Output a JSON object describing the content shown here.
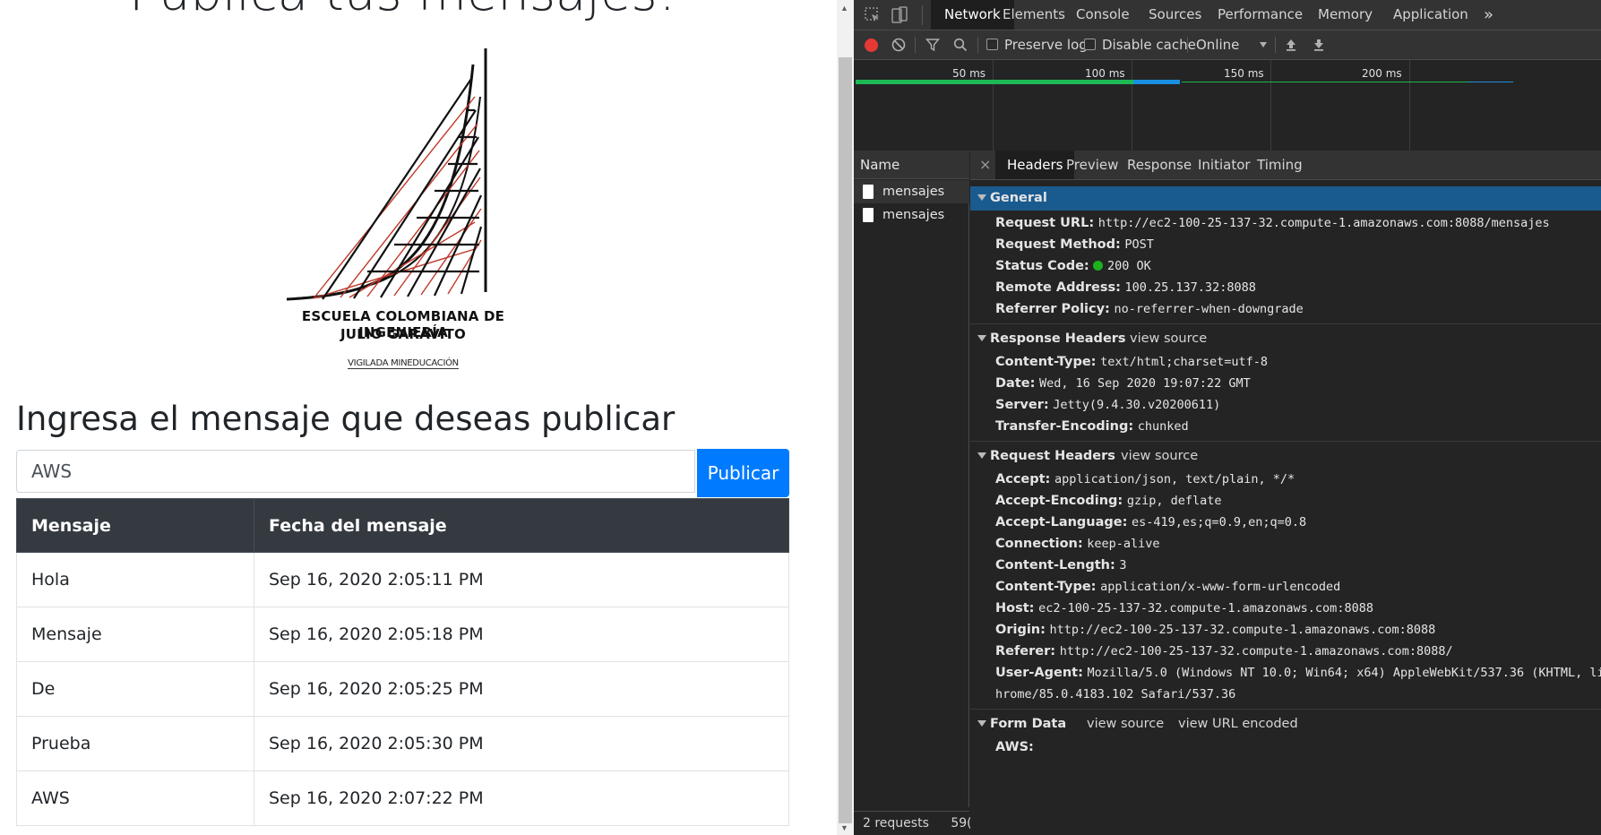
{
  "page": {
    "title": "Publica tus mensajes!",
    "logo": {
      "line1": "Escuela Colombiana de Ingeniería",
      "line2": "Julio Garavito",
      "line3": "VIGILADA MINEDUCACIÓN"
    },
    "heading": "Ingresa el mensaje que deseas publicar",
    "input_value": "AWS",
    "publish_label": "Publicar",
    "table": {
      "headers": [
        "Mensaje",
        "Fecha del mensaje"
      ],
      "rows": [
        [
          "Hola",
          "Sep 16, 2020 2:05:11 PM"
        ],
        [
          "Mensaje",
          "Sep 16, 2020 2:05:18 PM"
        ],
        [
          "De",
          "Sep 16, 2020 2:05:25 PM"
        ],
        [
          "Prueba",
          "Sep 16, 2020 2:05:30 PM"
        ],
        [
          "AWS",
          "Sep 16, 2020 2:07:22 PM"
        ]
      ]
    }
  },
  "devtools": {
    "tabs": [
      "Network",
      "Elements",
      "Console",
      "Sources",
      "Performance",
      "Memory",
      "Application"
    ],
    "more_tabs": "»",
    "toolbar": {
      "preserve_log": "Preserve log",
      "disable_cache": "Disable cache",
      "throttle": "Online"
    },
    "timeline_ticks": [
      "50 ms",
      "100 ms",
      "150 ms",
      "200 ms"
    ],
    "name_header": "Name",
    "requests": [
      "mensajes",
      "mensajes"
    ],
    "status_bar": "2 requests",
    "status_bar_cut": "59(",
    "detail_tabs": [
      "Headers",
      "Preview",
      "Response",
      "Initiator",
      "Timing"
    ],
    "close_glyph": "×",
    "general": {
      "title": "General",
      "items": [
        {
          "k": "Request URL:",
          "v": "http://ec2-100-25-137-32.compute-1.amazonaws.com:8088/mensajes"
        },
        {
          "k": "Request Method:",
          "v": "POST"
        },
        {
          "k": "Status Code:",
          "v": "200 OK"
        },
        {
          "k": "Remote Address:",
          "v": "100.25.137.32:8088"
        },
        {
          "k": "Referrer Policy:",
          "v": "no-referrer-when-downgrade"
        }
      ]
    },
    "response_headers": {
      "title": "Response Headers",
      "view_source": "view source",
      "items": [
        {
          "k": "Content-Type:",
          "v": "text/html;charset=utf-8"
        },
        {
          "k": "Date:",
          "v": "Wed, 16 Sep 2020 19:07:22 GMT"
        },
        {
          "k": "Server:",
          "v": "Jetty(9.4.30.v20200611)"
        },
        {
          "k": "Transfer-Encoding:",
          "v": "chunked"
        }
      ]
    },
    "request_headers": {
      "title": "Request Headers",
      "view_source": "view source",
      "items": [
        {
          "k": "Accept:",
          "v": "application/json, text/plain, */*"
        },
        {
          "k": "Accept-Encoding:",
          "v": "gzip, deflate"
        },
        {
          "k": "Accept-Language:",
          "v": "es-419,es;q=0.9,en;q=0.8"
        },
        {
          "k": "Connection:",
          "v": "keep-alive"
        },
        {
          "k": "Content-Length:",
          "v": "3"
        },
        {
          "k": "Content-Type:",
          "v": "application/x-www-form-urlencoded"
        },
        {
          "k": "Host:",
          "v": "ec2-100-25-137-32.compute-1.amazonaws.com:8088"
        },
        {
          "k": "Origin:",
          "v": "http://ec2-100-25-137-32.compute-1.amazonaws.com:8088"
        },
        {
          "k": "Referer:",
          "v": "http://ec2-100-25-137-32.compute-1.amazonaws.com:8088/"
        },
        {
          "k": "User-Agent:",
          "v": "Mozilla/5.0 (Windows NT 10.0; Win64; x64) AppleWebKit/537.36 (KHTML, li"
        }
      ],
      "user_agent_cont": "hrome/85.0.4183.102 Safari/537.36"
    },
    "form_data": {
      "title": "Form Data",
      "view_source": "view source",
      "view_url_encoded": "view URL encoded",
      "items": [
        {
          "k": "AWS:",
          "v": ""
        }
      ]
    }
  },
  "colors": {
    "primary": "#007bff",
    "table_header": "#343a40",
    "devtools_bg": "#242424",
    "selected_row": "#1a5b8f",
    "status_ok": "#1db11d",
    "record": "#e53935",
    "timeline_green": "#1db954",
    "timeline_blue": "#1a8fe0"
  }
}
